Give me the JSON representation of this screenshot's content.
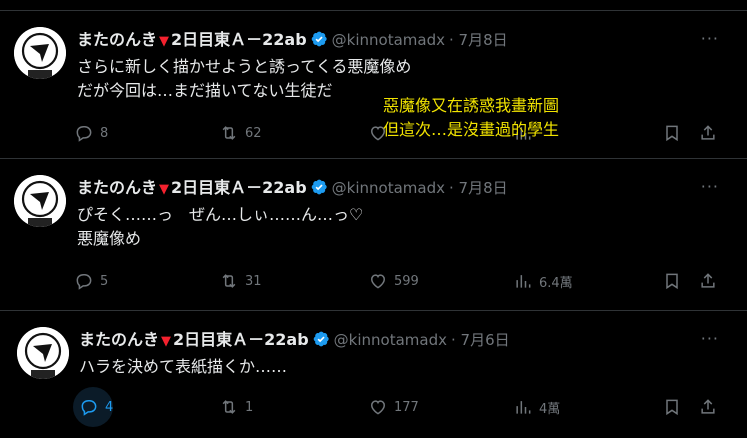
{
  "tweets": [
    {
      "author": "またのんき",
      "heart": "▼",
      "author_suffix": "2日目東Ａ－22ab",
      "handle": "@kinnotamadx",
      "date": "· 7月8日",
      "text": "さらに新しく描かせようと誘ってくる悪魔像め\nだが今回は…まだ描いてない生徒だ",
      "replies": "8",
      "retweets": "62",
      "likes": "",
      "views": ""
    },
    {
      "author": "またのんき",
      "heart": "▼",
      "author_suffix": "2日目東Ａ－22ab",
      "handle": "@kinnotamadx",
      "date": "· 7月8日",
      "text": "ぴそく……っ　ぜん…しぃ……ん…っ♡\n悪魔像め",
      "replies": "5",
      "retweets": "31",
      "likes": "599",
      "views": "6.4萬"
    },
    {
      "author": "またのんき",
      "heart": "▼",
      "author_suffix": "2日目東Ａ－22ab",
      "handle": "@kinnotamadx",
      "date": "· 7月6日",
      "text": "ハラを決めて表紙描くか……",
      "replies": "4",
      "retweets": "1",
      "likes": "177",
      "views": "4萬"
    }
  ],
  "more_label": "···",
  "overlay_caption": "惡魔像又在誘惑我畫新圖\n但這次…是沒畫過的學生",
  "colors": {
    "accent": "#1d9bf0",
    "heart_triangle": "#f4212e",
    "overlay": "#f2e400"
  },
  "icons": [
    "reply-icon",
    "retweet-icon",
    "like-icon",
    "views-icon",
    "bookmark-icon",
    "share-icon",
    "verified-icon",
    "more-icon"
  ]
}
